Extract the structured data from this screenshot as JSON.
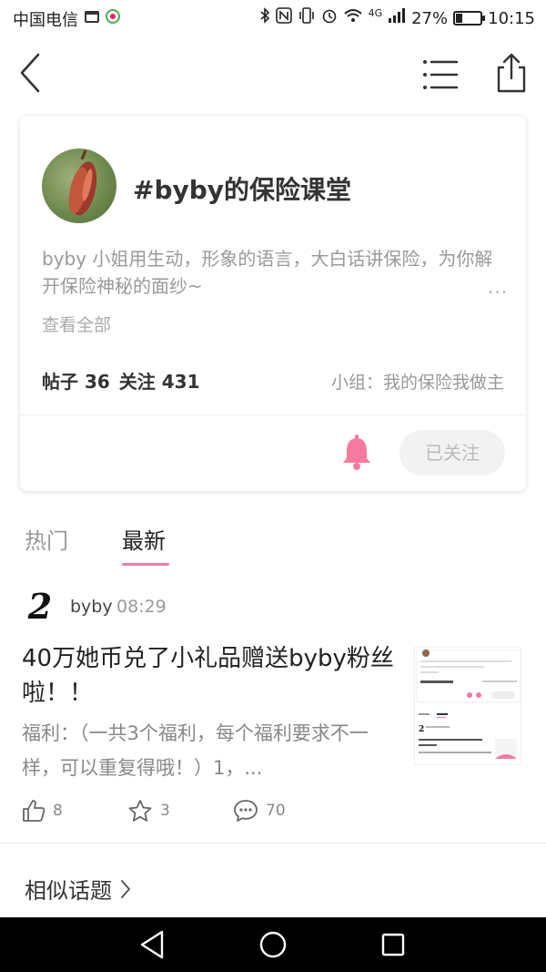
{
  "statusbar": {
    "carrier": "中国电信",
    "network": "4G",
    "battery_percent": "27%",
    "battery_level": 0.27,
    "time": "10:15"
  },
  "topic": {
    "title": "#byby的保险课堂",
    "description": "byby 小姐用生动，形象的语言，大白话讲保险，为你解开保险神秘的面纱~",
    "more": "···",
    "view_all": "查看全部",
    "posts_stat": "帖子 36",
    "follow_stat": "关注 431",
    "group": "小组：我的保险我做主",
    "follow_button": "已关注",
    "accent_color": "#f57aa0"
  },
  "tabs": [
    {
      "label": "热门",
      "active": false
    },
    {
      "label": "最新",
      "active": true
    }
  ],
  "post": {
    "avatar_text": "2",
    "author": "byby",
    "time": "08:29",
    "title": "40万她币兑了小礼品赠送byby粉丝啦！！",
    "excerpt": "福利：（一共3个福利，每个福利要求不一样，可以重复得哦！）1，...",
    "likes": "8",
    "favorites": "3",
    "comments": "70"
  },
  "related": {
    "label": "相似话题"
  },
  "icons": {
    "back": "back-icon",
    "menu": "menu-icon",
    "share": "share-icon",
    "bell": "bell-icon",
    "like": "thumb-up-icon",
    "favorite": "star-icon",
    "comment": "comment-icon"
  }
}
